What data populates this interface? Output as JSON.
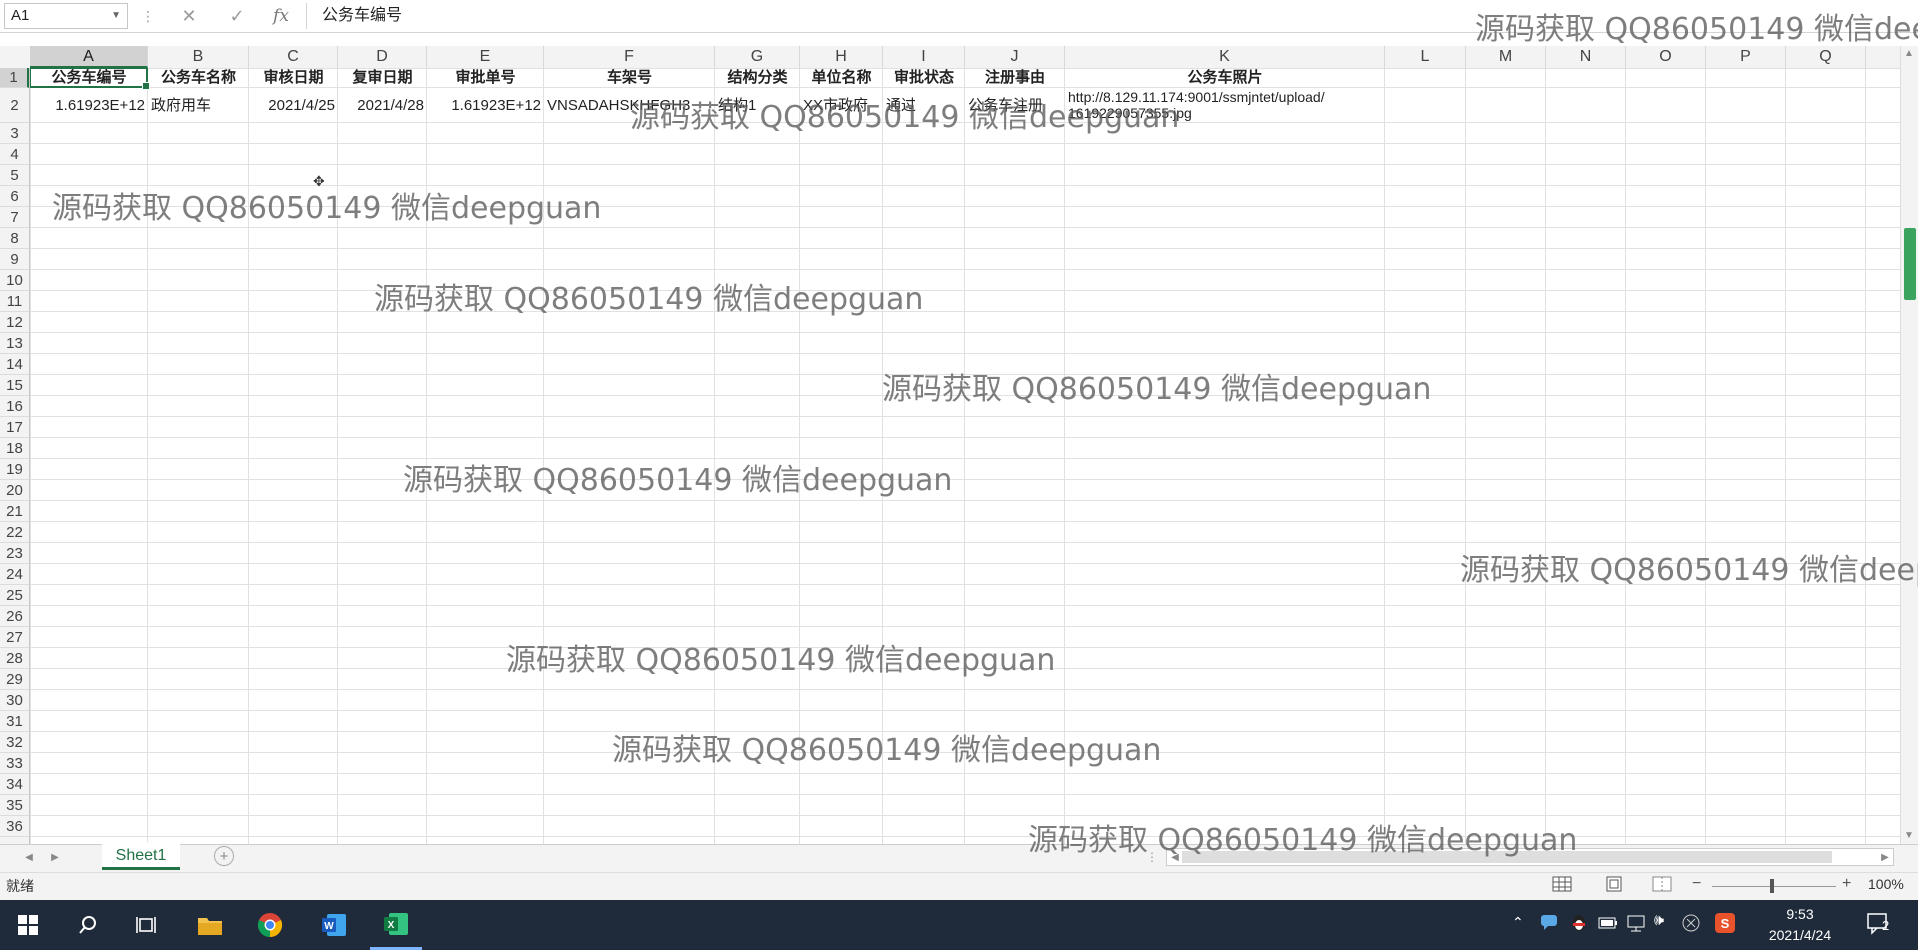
{
  "formula_bar": {
    "name_box": "A1",
    "content": "公务车编号"
  },
  "columns": [
    "A",
    "B",
    "C",
    "D",
    "E",
    "F",
    "G",
    "H",
    "I",
    "J",
    "K",
    "L",
    "M",
    "N",
    "O",
    "P",
    "Q"
  ],
  "rows": [
    "1",
    "2",
    "3",
    "4",
    "5",
    "6",
    "7",
    "8",
    "9",
    "10",
    "11",
    "12",
    "13",
    "14",
    "15",
    "16",
    "17",
    "18",
    "19",
    "20",
    "21",
    "22",
    "23",
    "24",
    "25",
    "26",
    "27",
    "28",
    "29",
    "30",
    "31",
    "32",
    "33",
    "34",
    "35",
    "36"
  ],
  "table": {
    "headers": [
      "公务车编号",
      "公务车名称",
      "审核日期",
      "复审日期",
      "审批单号",
      "车架号",
      "结构分类",
      "单位名称",
      "审批状态",
      "注册事由",
      "公务车照片"
    ],
    "row2": [
      "1.61923E+12",
      "政府用车",
      "2021/4/25",
      "2021/4/28",
      "1.61923E+12",
      "VNSADAHSKHFGH3",
      "结构1",
      "XX市政府",
      "通过",
      "公务车注册",
      "http://8.129.11.174:9001/ssmjntet/upload/",
      "1619229057355.jpg"
    ]
  },
  "sheet_tab": "Sheet1",
  "status": {
    "ready": "就绪",
    "zoom": "100%"
  },
  "taskbar": {
    "time": "9:53",
    "date": "2021/4/24",
    "notifications": "2"
  },
  "watermark": "源码获取 QQ86050149 微信deepguan",
  "colors": {
    "excel_green": "#217346",
    "taskbar": "#1f2b3a"
  }
}
